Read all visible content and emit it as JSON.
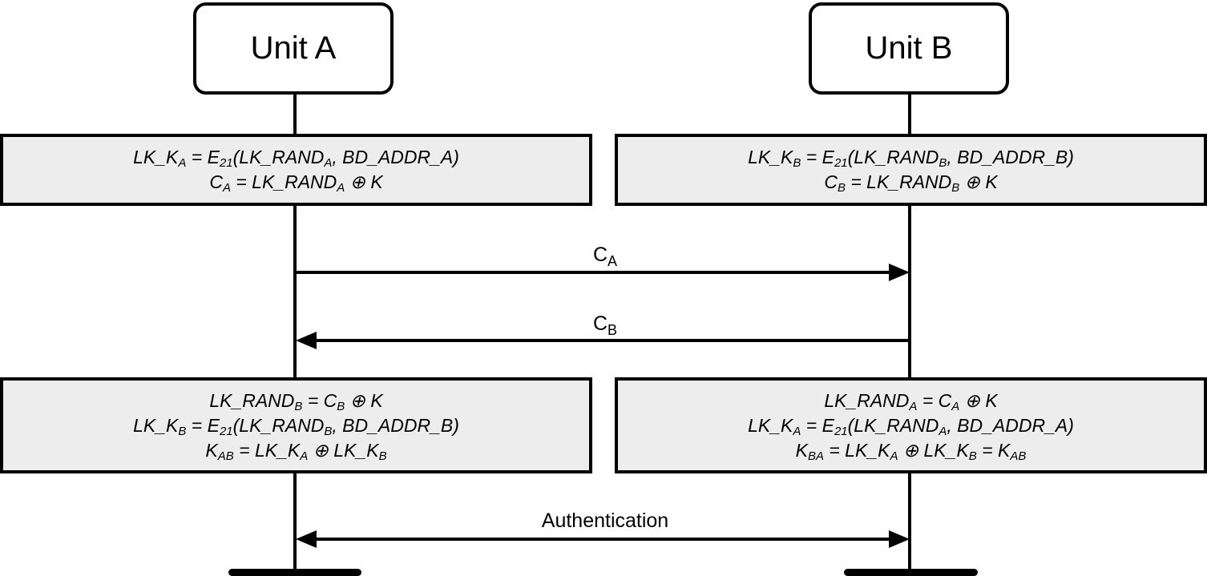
{
  "units": [
    {
      "label": "Unit A"
    },
    {
      "label": "Unit B"
    }
  ],
  "boxes": {
    "a_top": [
      {
        "parts": [
          [
            "LK_K",
            ""
          ],
          [
            "A",
            "sub"
          ],
          [
            " = E",
            ""
          ],
          [
            "21",
            "sub"
          ],
          [
            "(LK_RAND",
            ""
          ],
          [
            "A",
            "sub"
          ],
          [
            ", BD_ADDR_A)",
            ""
          ]
        ]
      },
      {
        "parts": [
          [
            "C",
            ""
          ],
          [
            "A",
            "sub"
          ],
          [
            " = LK_RAND",
            ""
          ],
          [
            "A",
            "sub"
          ],
          [
            " ⊕ K",
            ""
          ]
        ]
      }
    ],
    "b_top": [
      {
        "parts": [
          [
            "LK_K",
            ""
          ],
          [
            "B",
            "sub"
          ],
          [
            " = E",
            ""
          ],
          [
            "21",
            "sub"
          ],
          [
            "(LK_RAND",
            ""
          ],
          [
            "B",
            "sub"
          ],
          [
            ", BD_ADDR_B)",
            ""
          ]
        ]
      },
      {
        "parts": [
          [
            "C",
            ""
          ],
          [
            "B",
            "sub"
          ],
          [
            " = LK_RAND",
            ""
          ],
          [
            "B",
            "sub"
          ],
          [
            " ⊕ K",
            ""
          ]
        ]
      }
    ],
    "a_bottom": [
      {
        "parts": [
          [
            "LK_RAND",
            ""
          ],
          [
            "B",
            "sub"
          ],
          [
            " = C",
            ""
          ],
          [
            "B",
            "sub"
          ],
          [
            " ⊕ K",
            ""
          ]
        ]
      },
      {
        "parts": [
          [
            "LK_K",
            ""
          ],
          [
            "B",
            "sub"
          ],
          [
            " = E",
            ""
          ],
          [
            "21",
            "sub"
          ],
          [
            "(LK_RAND",
            ""
          ],
          [
            "B",
            "sub"
          ],
          [
            ", BD_ADDR_B)",
            ""
          ]
        ]
      },
      {
        "parts": [
          [
            "K",
            ""
          ],
          [
            "AB",
            "sub"
          ],
          [
            " = LK_K",
            ""
          ],
          [
            "A",
            "sub"
          ],
          [
            " ⊕ LK_K",
            ""
          ],
          [
            "B",
            "sub"
          ]
        ]
      }
    ],
    "b_bottom": [
      {
        "parts": [
          [
            "LK_RAND",
            ""
          ],
          [
            "A",
            "sub"
          ],
          [
            " = C",
            ""
          ],
          [
            "A",
            "sub"
          ],
          [
            " ⊕ K",
            ""
          ]
        ]
      },
      {
        "parts": [
          [
            "LK_K",
            ""
          ],
          [
            "A",
            "sub"
          ],
          [
            " = E",
            ""
          ],
          [
            "21",
            "sub"
          ],
          [
            "(LK_RAND",
            ""
          ],
          [
            "A",
            "sub"
          ],
          [
            ", BD_ADDR_A)",
            ""
          ]
        ]
      },
      {
        "parts": [
          [
            "K",
            ""
          ],
          [
            "BA",
            "sub"
          ],
          [
            " = LK_K",
            ""
          ],
          [
            "A",
            "sub"
          ],
          [
            " ⊕ LK_K",
            ""
          ],
          [
            "B",
            "sub"
          ],
          [
            " = K",
            ""
          ],
          [
            "AB",
            "sub"
          ]
        ]
      }
    ]
  },
  "messages": {
    "ca": {
      "main": "C",
      "sub": "A",
      "direction": "A→B"
    },
    "cb": {
      "main": "C",
      "sub": "B",
      "direction": "B→A"
    },
    "auth": {
      "label": "Authentication",
      "direction": "bidirectional"
    }
  }
}
